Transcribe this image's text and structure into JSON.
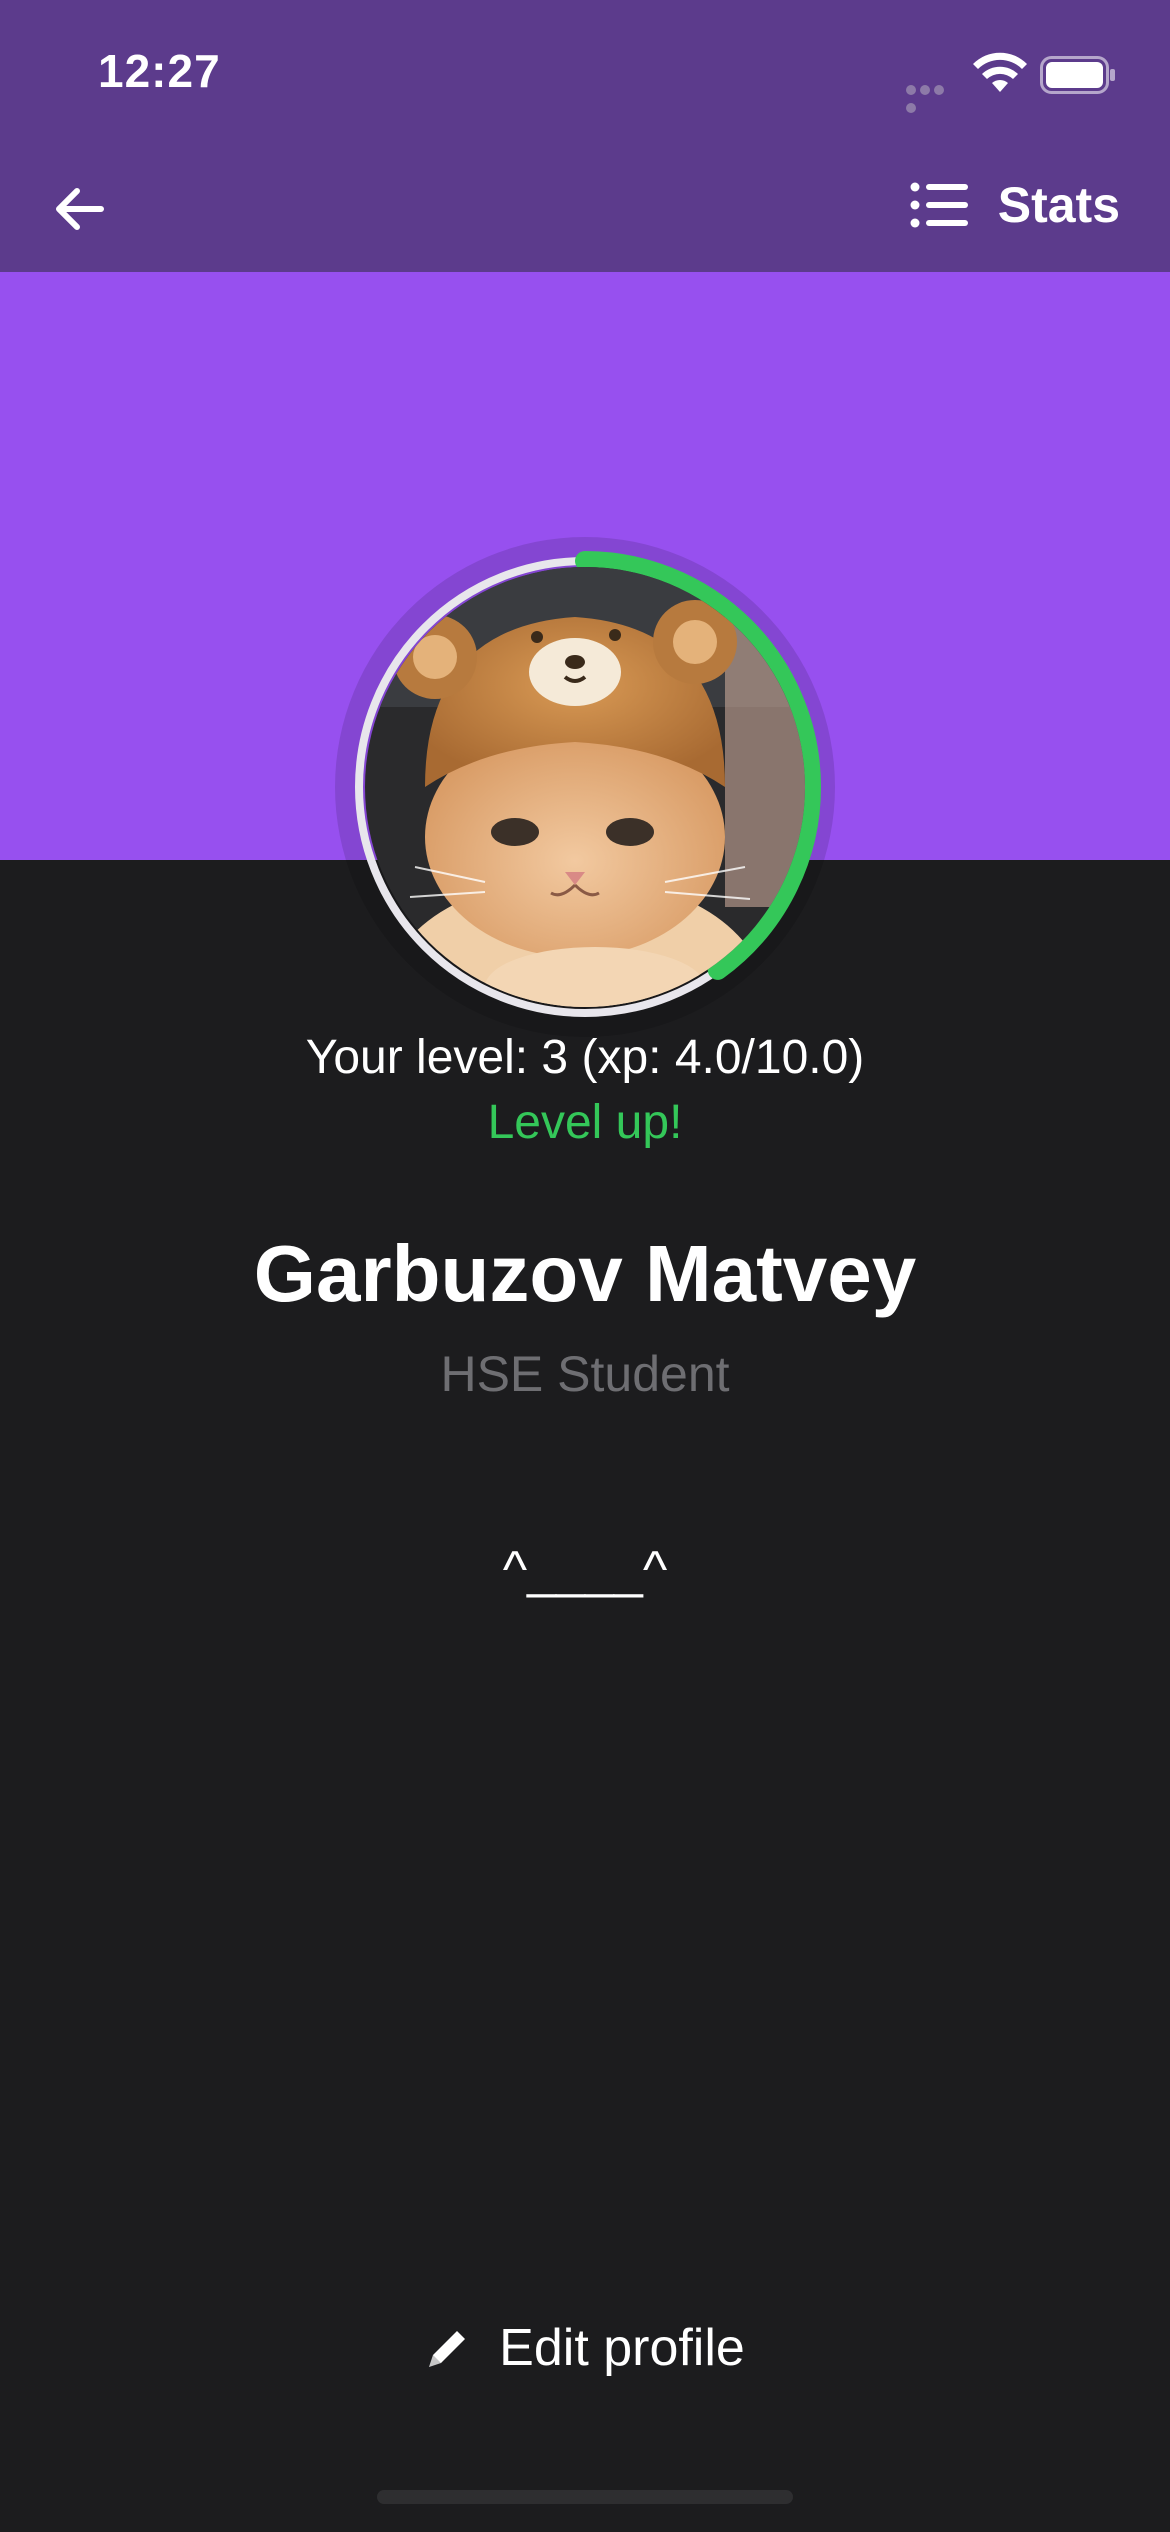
{
  "status_bar": {
    "time": "12:27",
    "icons": [
      "signal-dots-icon",
      "wifi-icon",
      "battery-icon"
    ]
  },
  "nav": {
    "back_icon": "arrow-left-icon",
    "stats_icon": "list-icon",
    "stats_label": "Stats"
  },
  "colors": {
    "nav_bg": "#5c3b8c",
    "hero_bg": "#9750ef",
    "page_bg": "#1c1c1e",
    "progress": "#34c759",
    "ring_track": "#e8e6ec",
    "secondary_text": "#6e6e72"
  },
  "profile": {
    "avatar_icon": "cat-in-bear-hat-avatar",
    "level_text": "Your level: 3 (xp: 4.0/10.0)",
    "level": 3,
    "xp_current": 4.0,
    "xp_max": 10.0,
    "xp_progress_fraction": 0.4,
    "level_up_label": "Level up!",
    "name": "Garbuzov Matvey",
    "role": "HSE Student",
    "bio": "^____^"
  },
  "actions": {
    "edit_icon": "pencil-icon",
    "edit_label": "Edit profile"
  }
}
